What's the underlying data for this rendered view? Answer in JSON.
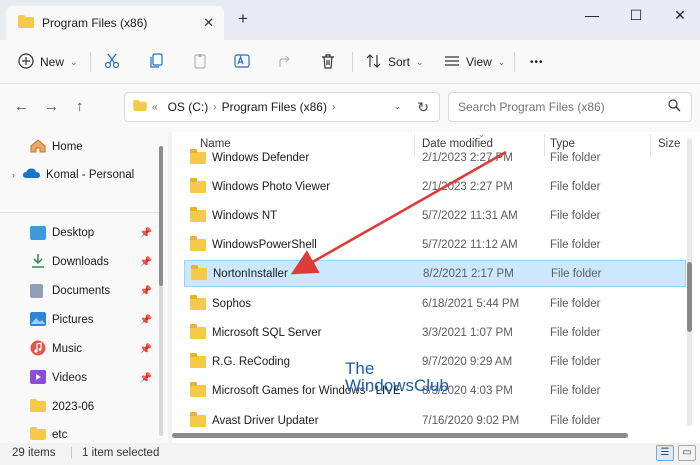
{
  "window": {
    "tab_title": "Program Files (x86)",
    "tab_close": "✕",
    "new_tab": "+",
    "minimize": "—",
    "maximize": "☐",
    "close": "✕"
  },
  "toolbar": {
    "new_label": "New",
    "sort_label": "Sort",
    "view_label": "View",
    "more_label": "•••"
  },
  "address": {
    "back": "←",
    "forward": "→",
    "up": "↑",
    "overflow": "«",
    "crumbs": [
      "OS (C:)",
      "Program Files (x86)"
    ],
    "search_placeholder": "Search Program Files (x86)"
  },
  "sidebar": {
    "items": [
      {
        "label": "Home",
        "icon": "home-icon",
        "color": "#e07b39",
        "pinned": false
      },
      {
        "label": "Komal - Personal",
        "icon": "cloud-icon",
        "color": "#1a73c9",
        "pinned": false
      },
      {
        "label": "Desktop",
        "icon": "desktop-icon",
        "color": "#3a9be0",
        "pinned": true
      },
      {
        "label": "Downloads",
        "icon": "download-icon",
        "color": "#2e8b57",
        "pinned": true
      },
      {
        "label": "Documents",
        "icon": "document-icon",
        "color": "#7a8ca3",
        "pinned": true
      },
      {
        "label": "Pictures",
        "icon": "pictures-icon",
        "color": "#2f86d6",
        "pinned": true
      },
      {
        "label": "Music",
        "icon": "music-icon",
        "color": "#e0584a",
        "pinned": true
      },
      {
        "label": "Videos",
        "icon": "videos-icon",
        "color": "#8a4fd6",
        "pinned": true
      },
      {
        "label": "2023-06",
        "icon": "folder-icon",
        "color": "#f7c948",
        "pinned": false
      },
      {
        "label": "etc",
        "icon": "folder-icon",
        "color": "#f7c948",
        "pinned": false
      }
    ]
  },
  "columns": {
    "name": "Name",
    "date": "Date modified",
    "type": "Type",
    "size": "Size"
  },
  "files": [
    {
      "name": "Windows Defender",
      "date": "2/1/2023 2:27 PM",
      "type": "File folder"
    },
    {
      "name": "Windows Photo Viewer",
      "date": "2/1/2023 2:27 PM",
      "type": "File folder"
    },
    {
      "name": "Windows NT",
      "date": "5/7/2022 11:31 AM",
      "type": "File folder"
    },
    {
      "name": "WindowsPowerShell",
      "date": "5/7/2022 11:12 AM",
      "type": "File folder"
    },
    {
      "name": "NortonInstaller",
      "date": "8/2/2021 2:17 PM",
      "type": "File folder",
      "selected": true
    },
    {
      "name": "Sophos",
      "date": "6/18/2021 5:44 PM",
      "type": "File folder"
    },
    {
      "name": "Microsoft SQL Server",
      "date": "3/3/2021 1:07 PM",
      "type": "File folder"
    },
    {
      "name": "R.G. ReCoding",
      "date": "9/7/2020 9:29 AM",
      "type": "File folder"
    },
    {
      "name": "Microsoft Games for Windows - LIVE",
      "date": "8/3/2020 4:03 PM",
      "type": "File folder"
    },
    {
      "name": "Avast Driver Updater",
      "date": "7/16/2020 9:02 PM",
      "type": "File folder"
    }
  ],
  "status": {
    "items": "29 items",
    "selected": "1 item selected"
  },
  "watermark": {
    "line1": "The",
    "line2": "WindowsClub"
  },
  "colors": {
    "selection": "#cce8ff",
    "arrow": "#e03b3b",
    "accent": "#0067c0"
  }
}
